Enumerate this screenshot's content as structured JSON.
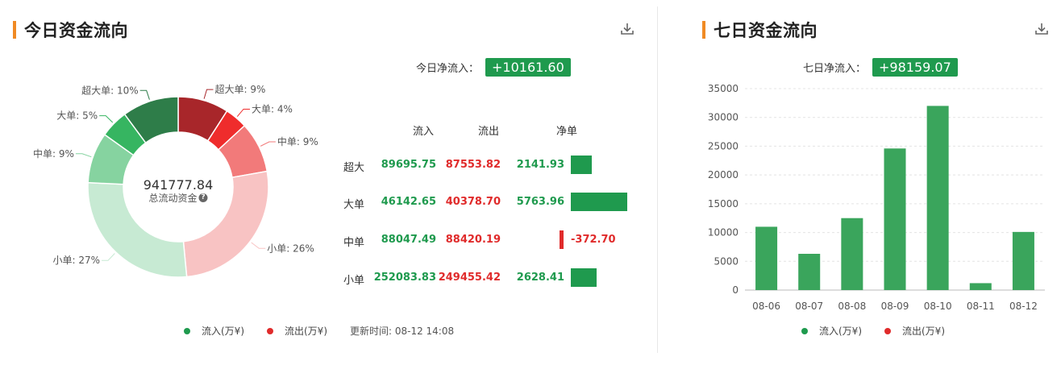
{
  "today": {
    "title": "今日资金流向",
    "net_label": "今日净流入：",
    "net_value": "+10161.60",
    "center_value": "941777.84",
    "center_label": "总流动资金",
    "legend": {
      "inflow": "流入(万¥)",
      "outflow": "流出(万¥)",
      "update_time": "更新时间: 08-12 14:08"
    },
    "table": {
      "headers": [
        "流入",
        "流出",
        "净单"
      ],
      "rows": [
        {
          "category": "超大",
          "inflow": "89695.75",
          "outflow": "87553.82",
          "net": "2141.93",
          "net_value": 2141.93
        },
        {
          "category": "大单",
          "inflow": "46142.65",
          "outflow": "40378.70",
          "net": "5763.96",
          "net_value": 5763.96
        },
        {
          "category": "中单",
          "inflow": "88047.49",
          "outflow": "88420.19",
          "net": "-372.70",
          "net_value": -372.7
        },
        {
          "category": "小单",
          "inflow": "252083.83",
          "outflow": "249455.42",
          "net": "2628.41",
          "net_value": 2628.41
        }
      ]
    }
  },
  "week": {
    "title": "七日资金流向",
    "net_label": "七日净流入：",
    "net_value": "+98159.07",
    "legend": {
      "inflow": "流入(万¥)",
      "outflow": "流出(万¥)"
    }
  },
  "colors": {
    "accent": "#f08a24",
    "green": "#1f9a4e",
    "red": "#e02b2b",
    "bar_green": "#3aa55c"
  },
  "icons": {
    "download": "download-icon",
    "help": "help-circle-icon"
  },
  "chart_data": [
    {
      "type": "pie",
      "title": "",
      "slices": [
        {
          "label": "超大单: 9%",
          "percent": 9,
          "color": "#a8262a"
        },
        {
          "label": "大单: 4%",
          "percent": 4,
          "color": "#ef2c2c"
        },
        {
          "label": "中单: 9%",
          "percent": 9,
          "color": "#f27a7a"
        },
        {
          "label": "小单: 26%",
          "percent": 26,
          "color": "#f8c3c3"
        },
        {
          "label": "小单: 27%",
          "percent": 27,
          "color": "#c7ead3"
        },
        {
          "label": "中单: 9%",
          "percent": 9,
          "color": "#86d3a0"
        },
        {
          "label": "大单: 5%",
          "percent": 5,
          "color": "#36b561"
        },
        {
          "label": "超大单: 10%",
          "percent": 10,
          "color": "#2e7d49"
        }
      ]
    },
    {
      "type": "bar",
      "title": "",
      "categories": [
        "08-06",
        "08-07",
        "08-08",
        "08-09",
        "08-10",
        "08-11",
        "08-12"
      ],
      "values": [
        11000,
        6300,
        12500,
        24600,
        32000,
        1200,
        10100
      ],
      "ylim": [
        0,
        35000
      ],
      "yticks": [
        "0",
        "5000",
        "10000",
        "15000",
        "20000",
        "25000",
        "30000",
        "35000"
      ],
      "grid": true
    }
  ]
}
